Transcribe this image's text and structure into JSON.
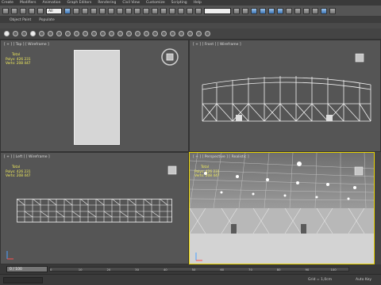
{
  "menu": {
    "items": [
      "Create",
      "Modifiers",
      "Animation",
      "Graph Editors",
      "Rendering",
      "Civil View",
      "Customize",
      "Scripting",
      "Help"
    ]
  },
  "toolbar": {
    "selection_filter": "All"
  },
  "ribbon": {
    "tabs": [
      "Object Paint",
      "Populate"
    ]
  },
  "viewports": {
    "top": {
      "label": "[ + ] [ Top ] [ Wireframe ]",
      "total_label": "Total",
      "polys_label": "Polys:",
      "polys_value": "426 231",
      "verts_label": "Verts:",
      "verts_value": "208 447"
    },
    "front": {
      "label": "[ + ] [ Front ] [ Wireframe ]"
    },
    "left": {
      "label": "[ + ] [ Left ] [ Wireframe ]",
      "total_label": "Total",
      "polys_label": "Polys:",
      "polys_value": "426 231",
      "verts_label": "Verts:",
      "verts_value": "208 447"
    },
    "persp": {
      "label": "[ + ] [ Perspective ] [ Realistic ]",
      "total_label": "Total",
      "polys_label": "Polys:",
      "polys_value": "426 231",
      "verts_label": "Verts:",
      "verts_value": "208 447"
    }
  },
  "timeline": {
    "frame_counter": "0 / 100",
    "ticks": [
      "0",
      "10",
      "20",
      "30",
      "40",
      "50",
      "60",
      "70",
      "80",
      "90",
      "100"
    ]
  },
  "status": {
    "grid": "Grid = 1,0cm",
    "autokey": "Auto Key"
  },
  "colors": {
    "stats_text": "#f3ee5c",
    "active_viewport_border": "#e9d400"
  }
}
